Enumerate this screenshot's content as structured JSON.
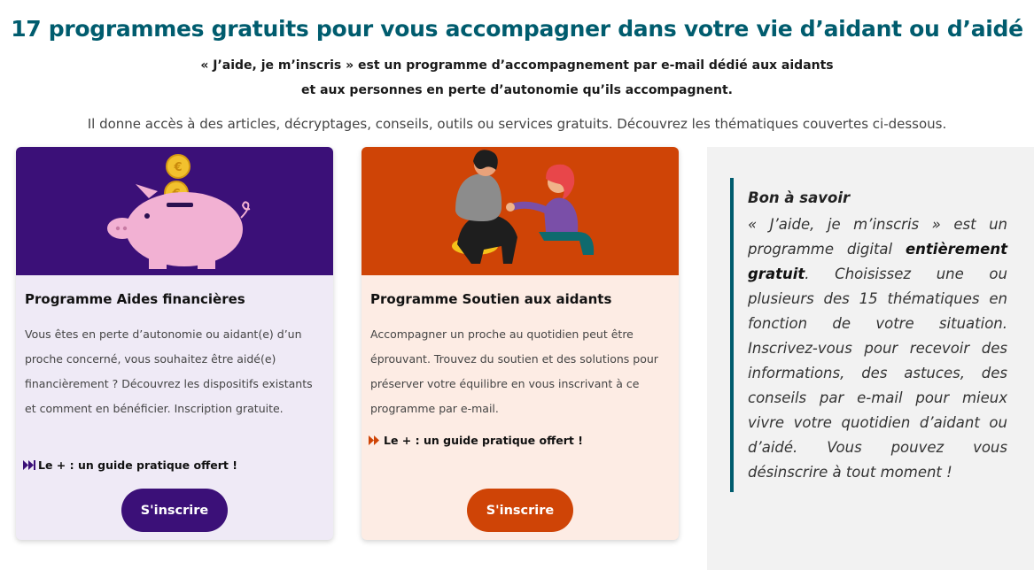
{
  "header": {
    "title": "17 programmes gratuits pour vous accompagner dans votre vie d’aidant ou d’aidé",
    "subtitle_line1": "« J’aide, je m’inscris » est un programme d’accompagnement par e-mail dédié aux aidants",
    "subtitle_line2": "et aux personnes en perte d’autonomie qu’ils accompagnent.",
    "description": "Il donne accès à des articles, décryptages, conseils, outils ou services gratuits. Découvrez les thématiques couvertes ci-dessous."
  },
  "cards": [
    {
      "title": "Programme Aides financières",
      "text": "Vous êtes en perte d’autonomie ou aidant(e) d’un proche concerné, vous souhaitez être aidé(e) financièrement ? Découvrez les dispositifs existants et comment en bénéficier. Inscription gratuite.",
      "plus": "Le + : un guide pratique offert !",
      "button": "S'inscrire",
      "icon": "piggy-bank-illustration",
      "color": "#3b1078"
    },
    {
      "title": "Programme Soutien aux aidants",
      "text": "Accompagner un proche au quotidien peut être éprouvant. Trouvez du soutien et des solutions pour préserver votre équilibre en vous inscrivant à ce programme par e-mail.",
      "plus": "Le + : un guide pratique offert !",
      "button": "S'inscrire",
      "icon": "support-illustration",
      "color": "#cf4406"
    }
  ],
  "aside": {
    "heading": "Bon à savoir",
    "text_part1": "« J’aide, je m’inscris » est un programme digital ",
    "text_bold": "entièrement gratuit",
    "text_part2": ". Choisissez une ou plusieurs des 15 thématiques en fonction de votre situation. Inscrivez-vous pour recevoir des informations, des astuces, des conseils par e-mail pour mieux vivre votre quotidien d’aidant ou d’aidé. Vous pouvez vous désinscrire à tout moment !"
  },
  "colors": {
    "accent": "#005c6e",
    "purple": "#3b1078",
    "orange": "#cf4406"
  }
}
